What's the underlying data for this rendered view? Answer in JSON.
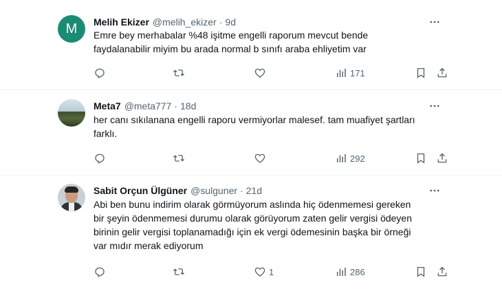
{
  "accent_color": "#1d9bf0",
  "tweets": [
    {
      "avatar": {
        "kind": "letter",
        "letter": "M",
        "color": "#1c8b74"
      },
      "name": "Melih Ekizer",
      "handle": "@melih_ekizer",
      "separator": "·",
      "time": "9d",
      "lines": [
        "Emre bey merhabalar %48 işitme engelli raporum mevcut bende",
        "faydalanabilir miyim bu arada normal b sınıfı araba ehliyetim var"
      ],
      "actions": {
        "replies": "",
        "retweets": "",
        "likes": "",
        "views": "171"
      }
    },
    {
      "avatar": {
        "kind": "photo",
        "icon": "landscape-photo"
      },
      "name": "Meta7",
      "handle": "@meta777",
      "separator": "·",
      "time": "18d",
      "lines": [
        "her canı sıkılanana engelli raporu vermiyorlar malesef. tam muafiyet şartları",
        "farklı."
      ],
      "actions": {
        "replies": "",
        "retweets": "",
        "likes": "",
        "views": "292"
      }
    },
    {
      "avatar": {
        "kind": "photo",
        "icon": "portrait-photo"
      },
      "name": "Sabit Orçun Ülgüner",
      "handle": "@sulguner",
      "separator": "·",
      "time": "21d",
      "lines": [
        "Abi ben bunu indirim olarak görmüyorum aslında hiç ödenmemesi gereken",
        "bir şeyin ödenmemesi durumu olarak görüyorum zaten gelir vergisi ödeyen",
        "birinin gelir vergisi toplanamadığı için ek vergi ödemesinin başka bir örneği",
        "var mıdır merak ediyorum"
      ],
      "actions": {
        "replies": "",
        "retweets": "",
        "likes": "1",
        "views": "286"
      }
    }
  ]
}
